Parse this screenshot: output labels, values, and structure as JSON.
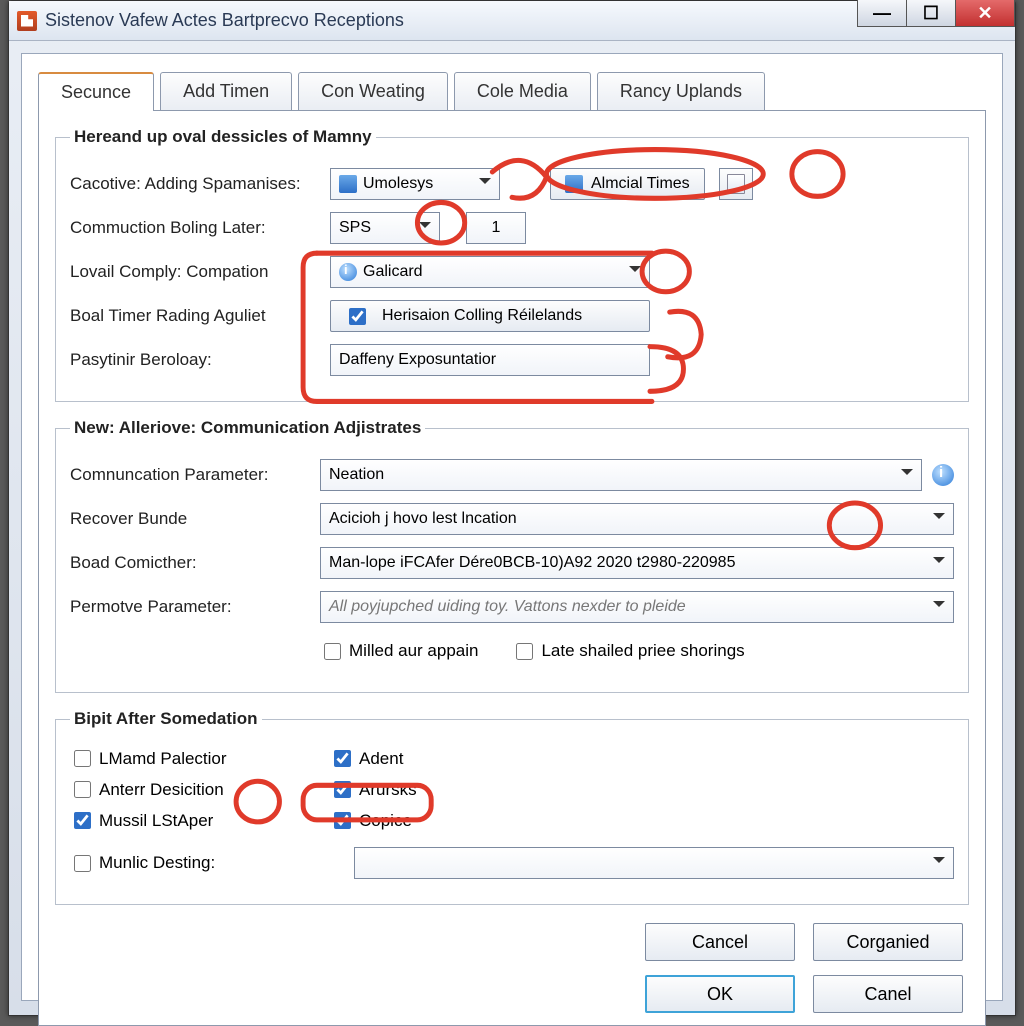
{
  "window": {
    "title": "Sistenov Vafew Actes Bartprecvo Receptions"
  },
  "tabs": [
    "Secunce",
    "Add Timen",
    "Con Weating",
    "Cole Media",
    "Rancy Uplands"
  ],
  "activeTab": 0,
  "group1": {
    "legend": "Hereand up oval dessicles of Mamny",
    "labels": {
      "cacotive": "Cacotive: Adding Spamanises:",
      "commuction": "Commuction Boling Later:",
      "lovail": "Lovail Comply: Compation",
      "boal": "Boal Timer Rading Aguliet",
      "pasytinir": "Pasytinir Beroloay:"
    },
    "cacotive_select": "Umolesys",
    "almcial_btn": "Almcial Times",
    "commuction_select": "SPS",
    "commuction_num": "1",
    "lovail_select": "Galicard",
    "boal_check_label": "Herisaion Colling Réilelands",
    "boal_checked": true,
    "pasytinir_value": "Daffeny Exposuntatior"
  },
  "group2": {
    "legend": "New: Alleriove: Communication Adjistrates",
    "labels": {
      "comm": "Comnuncation Parameter:",
      "recover": "Recover Bunde",
      "boad": "Boad Comicther:",
      "permotve": "Permotve Parameter:"
    },
    "comm_select": "Neation",
    "recover_select": "Acicioh j hovo lest lncation",
    "boad_select": "Man-lope iFCAfer Dére0BCB-10)A92 2020 t2980-220985",
    "permotve_select": "All poyjupched uiding toy. Vattons nexder to pleide",
    "milled_label": "Milled aur appain",
    "late_label": "Late shailed priee shorings"
  },
  "group3": {
    "legend": "Bipit After Somedation",
    "left": [
      {
        "label": "LMamd Palectior",
        "checked": false
      },
      {
        "label": "Anterr Desicition",
        "checked": false
      },
      {
        "label": "Mussil LStAper",
        "checked": true
      }
    ],
    "right": [
      {
        "label": "Adent",
        "checked": true
      },
      {
        "label": "Arursks",
        "checked": true
      },
      {
        "label": "Copice",
        "checked": true
      }
    ],
    "munlic_label": "Munlic Desting:"
  },
  "buttons": {
    "cancel1": "Cancel",
    "corganied": "Corganied",
    "ok": "OK",
    "cancel2": "Canel"
  },
  "annotation_color": "#e03a2a"
}
